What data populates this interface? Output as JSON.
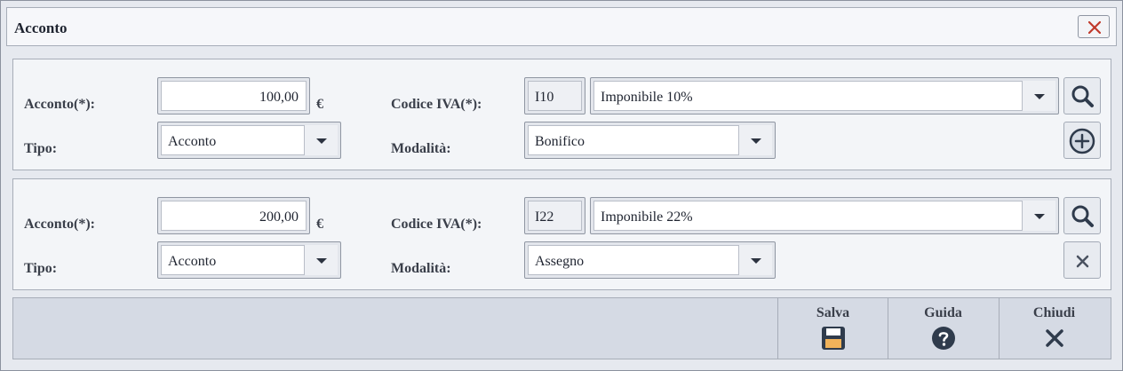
{
  "window": {
    "title": "Acconto"
  },
  "rows": [
    {
      "acconto_label": "Acconto(*):",
      "amount": "100,00",
      "currency": "€",
      "codice_iva_label": "Codice IVA(*):",
      "iva_code": "I10",
      "iva_desc": "Imponibile 10%",
      "tipo_label": "Tipo:",
      "tipo": "Acconto",
      "modalita_label": "Modalità:",
      "modalita": "Bonifico",
      "search_icon": "search-icon",
      "row_action_icon": "add-circle-icon"
    },
    {
      "acconto_label": "Acconto(*):",
      "amount": "200,00",
      "currency": "€",
      "codice_iva_label": "Codice IVA(*):",
      "iva_code": "I22",
      "iva_desc": "Imponibile 22%",
      "tipo_label": "Tipo:",
      "tipo": "Acconto",
      "modalita_label": "Modalità:",
      "modalita": "Assegno",
      "search_icon": "search-icon",
      "row_action_icon": "remove-icon"
    }
  ],
  "footer": {
    "save_label": "Salva",
    "help_label": "Guida",
    "close_label": "Chiudi"
  },
  "colors": {
    "close_x": "#c0392b",
    "icon_dark": "#2f3b4c",
    "panel_bg": "#f3f5f8",
    "footer_bg": "#d5dae4"
  }
}
